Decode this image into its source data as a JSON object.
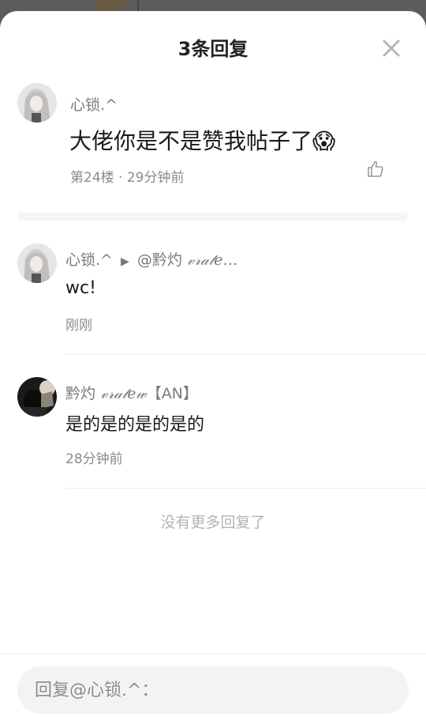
{
  "header": {
    "title": "3条回复"
  },
  "main_comment": {
    "username": "心锁.^",
    "content": "大佬你是不是赞我帖子了😱",
    "meta": "第24楼 · 29分钟前"
  },
  "replies": [
    {
      "username": "心锁.^",
      "reply_to": "@黔灼",
      "reply_to_suffix": "𝓋𝓇𝒶𝓉𝑒…",
      "content": "wc!",
      "time": "刚刚"
    },
    {
      "username": "黔灼",
      "username_suffix": "𝓋𝓇𝒶𝓉𝑒𝓌",
      "badge": "【AN】",
      "content": "是的是的是的是的",
      "time": "28分钟前"
    }
  ],
  "footer": {
    "no_more_text": "没有更多回复了",
    "reply_placeholder": "回复@心锁.^："
  },
  "icons": {
    "close": "close-icon",
    "like": "thumbs-up-icon",
    "reply_arrow": "play-arrow-icon"
  },
  "colors": {
    "sheet_bg": "#ffffff",
    "username": "#7a7a7a",
    "input_bg": "#f3f3f3"
  }
}
